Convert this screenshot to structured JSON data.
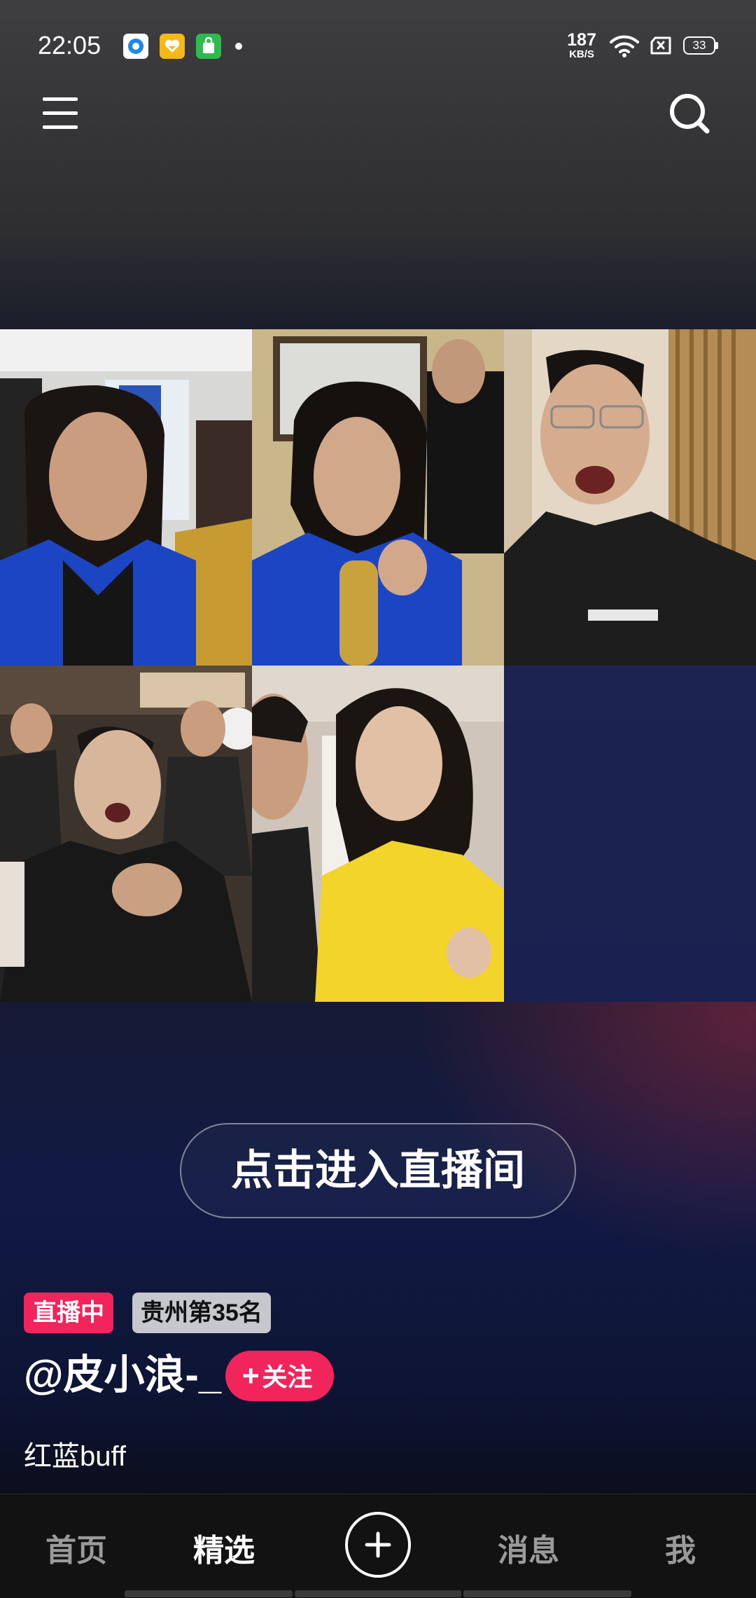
{
  "status_bar": {
    "time": "22:05",
    "network_speed_value": "187",
    "network_speed_unit": "KB/S",
    "battery_level": "33",
    "notification_icons": [
      "blue-circle-app-icon",
      "yellow-heart-app-icon",
      "green-shopping-bag-icon"
    ]
  },
  "header": {
    "menu_icon": "menu-icon",
    "search_icon": "search-icon"
  },
  "live_room": {
    "enter_label": "点击进入直播间",
    "status_badge": "直播中",
    "rank_badge": "贵州第35名",
    "username": "@皮小浪-_",
    "follow_label": "关注",
    "description": "红蓝buff",
    "streams": [
      "stream-1",
      "stream-2",
      "stream-3",
      "stream-4",
      "stream-5"
    ]
  },
  "tabbar": {
    "home": "首页",
    "featured": "精选",
    "messages": "消息",
    "me": "我",
    "active": "featured"
  },
  "colors": {
    "accent_pink": "#f2245c",
    "grid_empty_slot": "#1c2350"
  }
}
